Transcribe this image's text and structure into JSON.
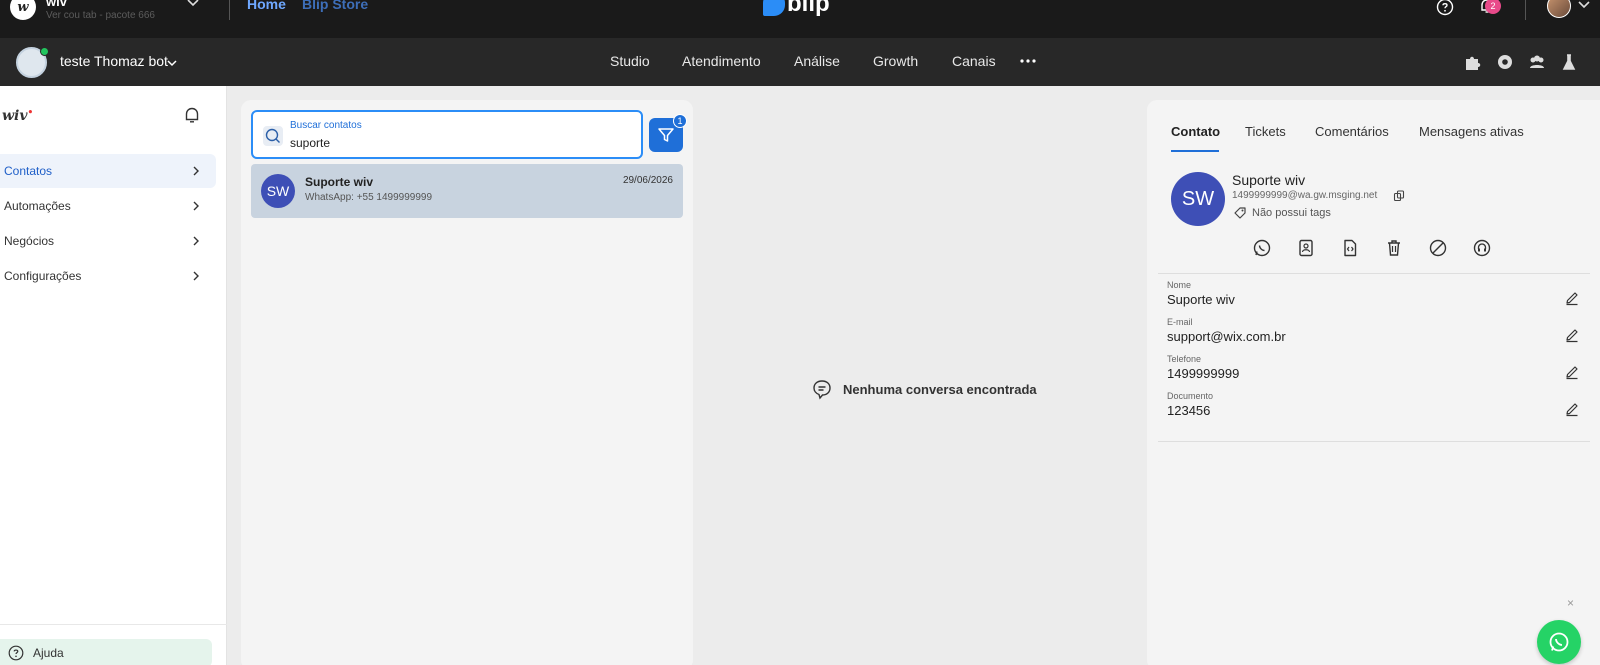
{
  "topbar": {
    "org_logo_letter": "w",
    "org_name": "wiv",
    "org_sub": "Ver cou tab - pacote 666",
    "nav_home": "Home",
    "nav_store": "Blip Store",
    "brand": "blip",
    "notification_count": "2",
    "icons": [
      "help-icon",
      "bell-icon",
      "user-avatar",
      "chevron-down-icon"
    ]
  },
  "botbar": {
    "bot_name": "teste Thomaz bot",
    "nav": [
      "Studio",
      "Atendimento",
      "Análise",
      "Growth",
      "Canais"
    ],
    "tools": [
      "puzzle-icon",
      "gear-icon",
      "team-icon",
      "flask-icon"
    ]
  },
  "sidebar": {
    "logo": "wiv",
    "items": [
      {
        "label": "Contatos"
      },
      {
        "label": "Automações"
      },
      {
        "label": "Negócios"
      },
      {
        "label": "Configurações"
      }
    ],
    "help_label": "Ajuda"
  },
  "contacts": {
    "search_label": "Buscar contatos",
    "search_value": "suporte",
    "filter_count": "1",
    "results": [
      {
        "initials": "SW",
        "name": "Suporte wiv",
        "channel": "WhatsApp: +55 1499999999",
        "date": "29/06/2026"
      }
    ]
  },
  "conversation": {
    "empty_text": "Nenhuma conversa encontrada"
  },
  "detail": {
    "tabs": [
      "Contato",
      "Tickets",
      "Comentários",
      "Mensagens ativas"
    ],
    "initials": "SW",
    "name": "Suporte wiv",
    "identity": "1499999999@wa.gw.msging.net",
    "tags": "Não possui tags",
    "actions": [
      "whatsapp-icon",
      "contact-card-icon",
      "code-file-icon",
      "trash-icon",
      "block-icon",
      "headset-icon"
    ],
    "fields": [
      {
        "label": "Nome",
        "value": "Suporte wiv"
      },
      {
        "label": "E-mail",
        "value": "support@wix.com.br"
      },
      {
        "label": "Telefone",
        "value": "1499999999"
      },
      {
        "label": "Documento",
        "value": "123456"
      }
    ],
    "close": "×"
  },
  "colors": {
    "accent": "#1f6fd8",
    "avatar": "#3e4fb6",
    "whatsapp": "#25d366",
    "badge": "#e84a8a"
  }
}
